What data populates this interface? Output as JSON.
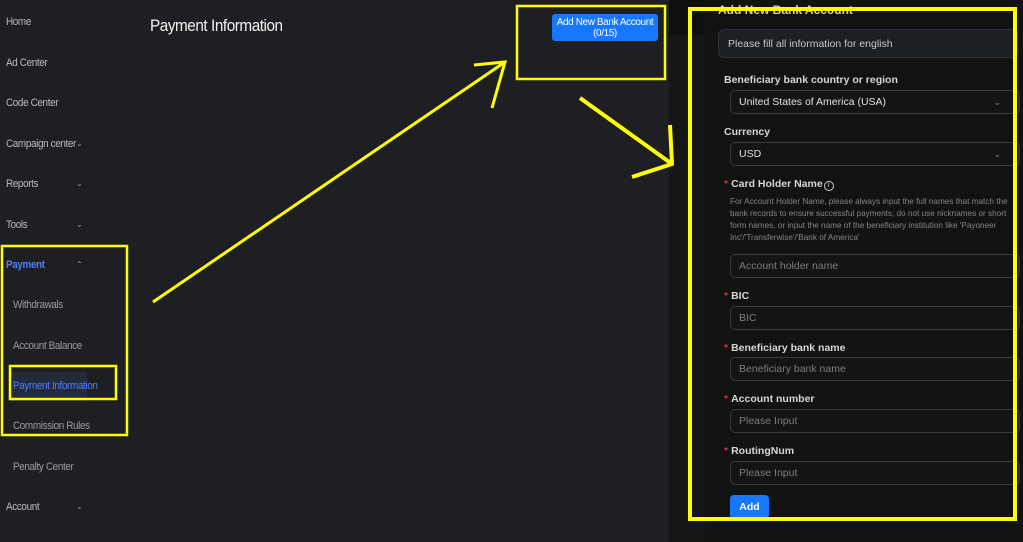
{
  "sidebar": {
    "items": [
      {
        "label": "Home"
      },
      {
        "label": "Ad Center"
      },
      {
        "label": "Code Center"
      },
      {
        "label": "Campaign center",
        "chevron": "chevron-down"
      },
      {
        "label": "Reports",
        "chevron": "chevron-down"
      },
      {
        "label": "Tools",
        "chevron": "chevron-down"
      },
      {
        "label": "Payment",
        "chevron": "chevron-up",
        "active": true
      },
      {
        "label": "Withdrawals"
      },
      {
        "label": "Account Balance"
      },
      {
        "label": "Payment Information",
        "active": true
      },
      {
        "label": "Commission Rules"
      },
      {
        "label": "Penalty Center"
      },
      {
        "label": "Account",
        "chevron": "chevron-down"
      }
    ]
  },
  "header": {
    "title": "Payment Information",
    "add_button": "Add New Bank Account (0/15)"
  },
  "drawer": {
    "title": "Add New Bank Account",
    "info": "Please fill all information for english",
    "country_label": "Beneficiary bank country or region",
    "country_value": "United States of America (USA)",
    "currency_label": "Currency",
    "currency_value": "USD",
    "holder_label": "Card Holder Name",
    "holder_hint": "For Account Holder Name, please always input the full names that match the bank records to ensure successful payments, do not use nicknames or short form names, or input the name of the beneficiary institution like 'Payoneer Inc'/'Transferwise'/'Bank of America'",
    "holder_placeholder": "Account holder name",
    "bic_label": "BIC",
    "bic_placeholder": "BIC",
    "bank_label": "Beneficiary bank name",
    "bank_placeholder": "Beneficiary bank name",
    "account_label": "Account number",
    "account_placeholder": "Please Input",
    "routing_label": "RoutingNum",
    "routing_placeholder": "Please Input",
    "required_mark": "*",
    "add_button": "Add"
  },
  "colors": {
    "accent": "#1677ff",
    "active_nav": "#4d7cff",
    "annotation": "#ffff00",
    "required": "#d03040"
  }
}
